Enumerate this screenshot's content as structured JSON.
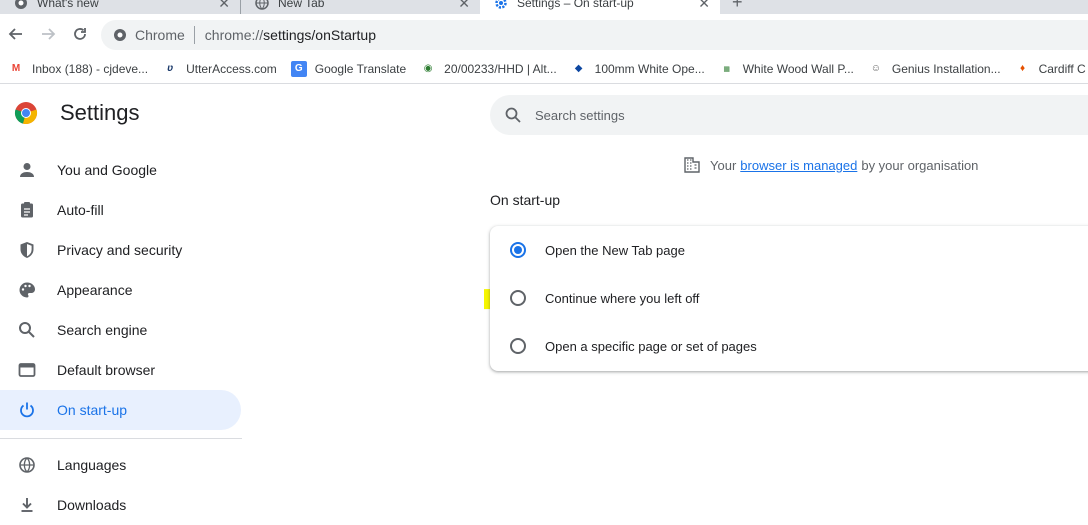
{
  "tabs": [
    {
      "title": "What's new",
      "active": false
    },
    {
      "title": "New Tab",
      "active": false
    },
    {
      "title": "Settings – On start-up",
      "active": true
    }
  ],
  "toolbar": {
    "chip_label": "Chrome",
    "url_scheme": "chrome://",
    "url_path": "settings/onStartup"
  },
  "bookmarks": [
    {
      "label": "Inbox (188) - cjdeve...",
      "icon": "gmail-icon",
      "color": "#ea4335"
    },
    {
      "label": "UtterAccess.com",
      "icon": "utteraccess-icon",
      "color": "#1b3a6b"
    },
    {
      "label": "Google Translate",
      "icon": "translate-icon",
      "color": "#4285f4"
    },
    {
      "label": "20/00233/HHD | Alt...",
      "icon": "council-icon",
      "color": "#2e7d32"
    },
    {
      "label": "100mm White Ope...",
      "icon": "layers-icon",
      "color": "#0d47a1"
    },
    {
      "label": "White Wood Wall P...",
      "icon": "easy-panels-icon",
      "color": "#2e7d32"
    },
    {
      "label": "Genius Installation...",
      "icon": "genius-icon",
      "color": "#616161"
    },
    {
      "label": "Cardiff C",
      "icon": "flame-icon",
      "color": "#e65100"
    }
  ],
  "settings": {
    "title": "Settings",
    "search_placeholder": "Search settings"
  },
  "sidebar": {
    "items": [
      {
        "label": "You and Google",
        "icon": "person-icon",
        "active": false
      },
      {
        "label": "Auto-fill",
        "icon": "clipboard-icon",
        "active": false
      },
      {
        "label": "Privacy and security",
        "icon": "shield-icon",
        "active": false
      },
      {
        "label": "Appearance",
        "icon": "palette-icon",
        "active": false
      },
      {
        "label": "Search engine",
        "icon": "search-icon",
        "active": false
      },
      {
        "label": "Default browser",
        "icon": "browser-window-icon",
        "active": false
      },
      {
        "label": "On start-up",
        "icon": "power-icon",
        "active": true
      }
    ],
    "items2": [
      {
        "label": "Languages",
        "icon": "globe-icon"
      },
      {
        "label": "Downloads",
        "icon": "download-icon"
      }
    ]
  },
  "managed": {
    "prefix": "Your",
    "link": "browser is managed",
    "suffix": "by your organisation"
  },
  "startup": {
    "section_title": "On start-up",
    "options": [
      {
        "label": "Open the New Tab page",
        "checked": true
      },
      {
        "label": "Continue where you left off",
        "checked": false
      },
      {
        "label": "Open a specific page or set of pages",
        "checked": false
      }
    ]
  },
  "colors": {
    "accent": "#1a73e8",
    "active_nav_bg": "#e8f0fe",
    "highlight": "#f6f600"
  }
}
